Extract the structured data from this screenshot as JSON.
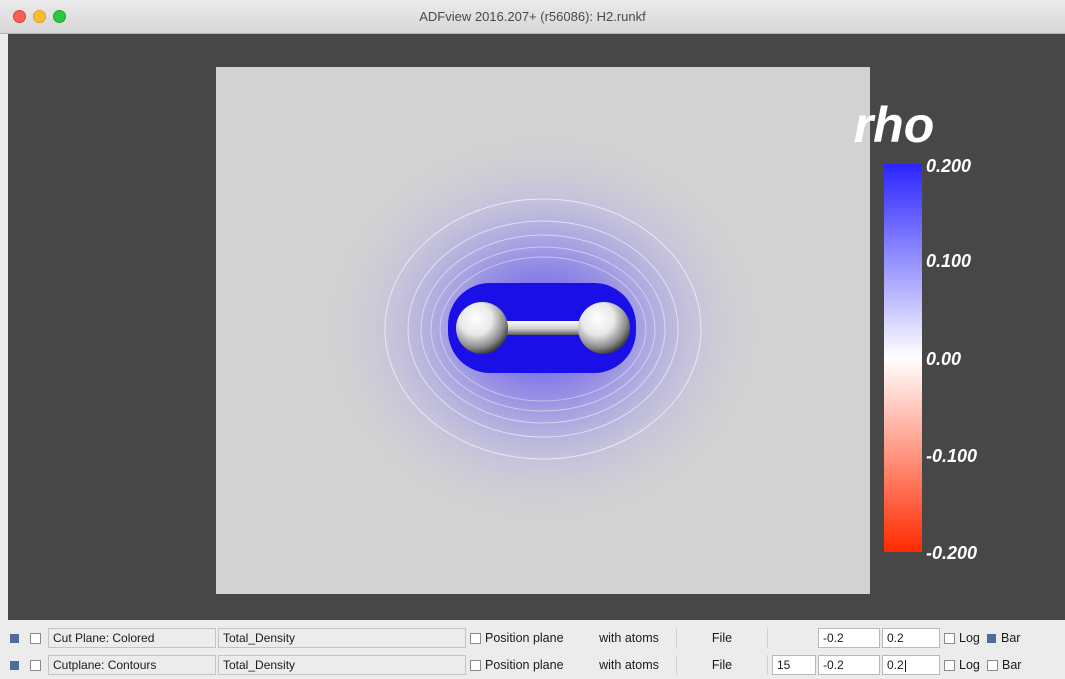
{
  "window": {
    "title": "ADFview 2016.207+ (r56086): H2.runkf"
  },
  "colorbar": {
    "title": "rho",
    "ticks": [
      "0.200",
      "0.100",
      "0.00",
      "-0.100",
      "-0.200"
    ],
    "colors": {
      "top": "#2b24ff",
      "mid": "#ffffff",
      "bottom": "#ff2a00"
    }
  },
  "plane": {
    "background": "#d2d2d2",
    "density_color": "#1a0fe6"
  },
  "rows": [
    {
      "name": "Cut Plane: Colored",
      "field": "Total_Density",
      "position_label": "Position plane",
      "atoms_button": "with atoms",
      "file_button": "File",
      "contours": "",
      "min": "-0.2",
      "max": "0.2",
      "log_label": "Log",
      "bar_label": "Bar"
    },
    {
      "name": "Cutplane: Contours",
      "field": "Total_Density",
      "position_label": "Position plane",
      "atoms_button": "with atoms",
      "file_button": "File",
      "contours": "15",
      "min": "-0.2",
      "max": "0.2",
      "log_label": "Log",
      "bar_label": "Bar"
    }
  ]
}
